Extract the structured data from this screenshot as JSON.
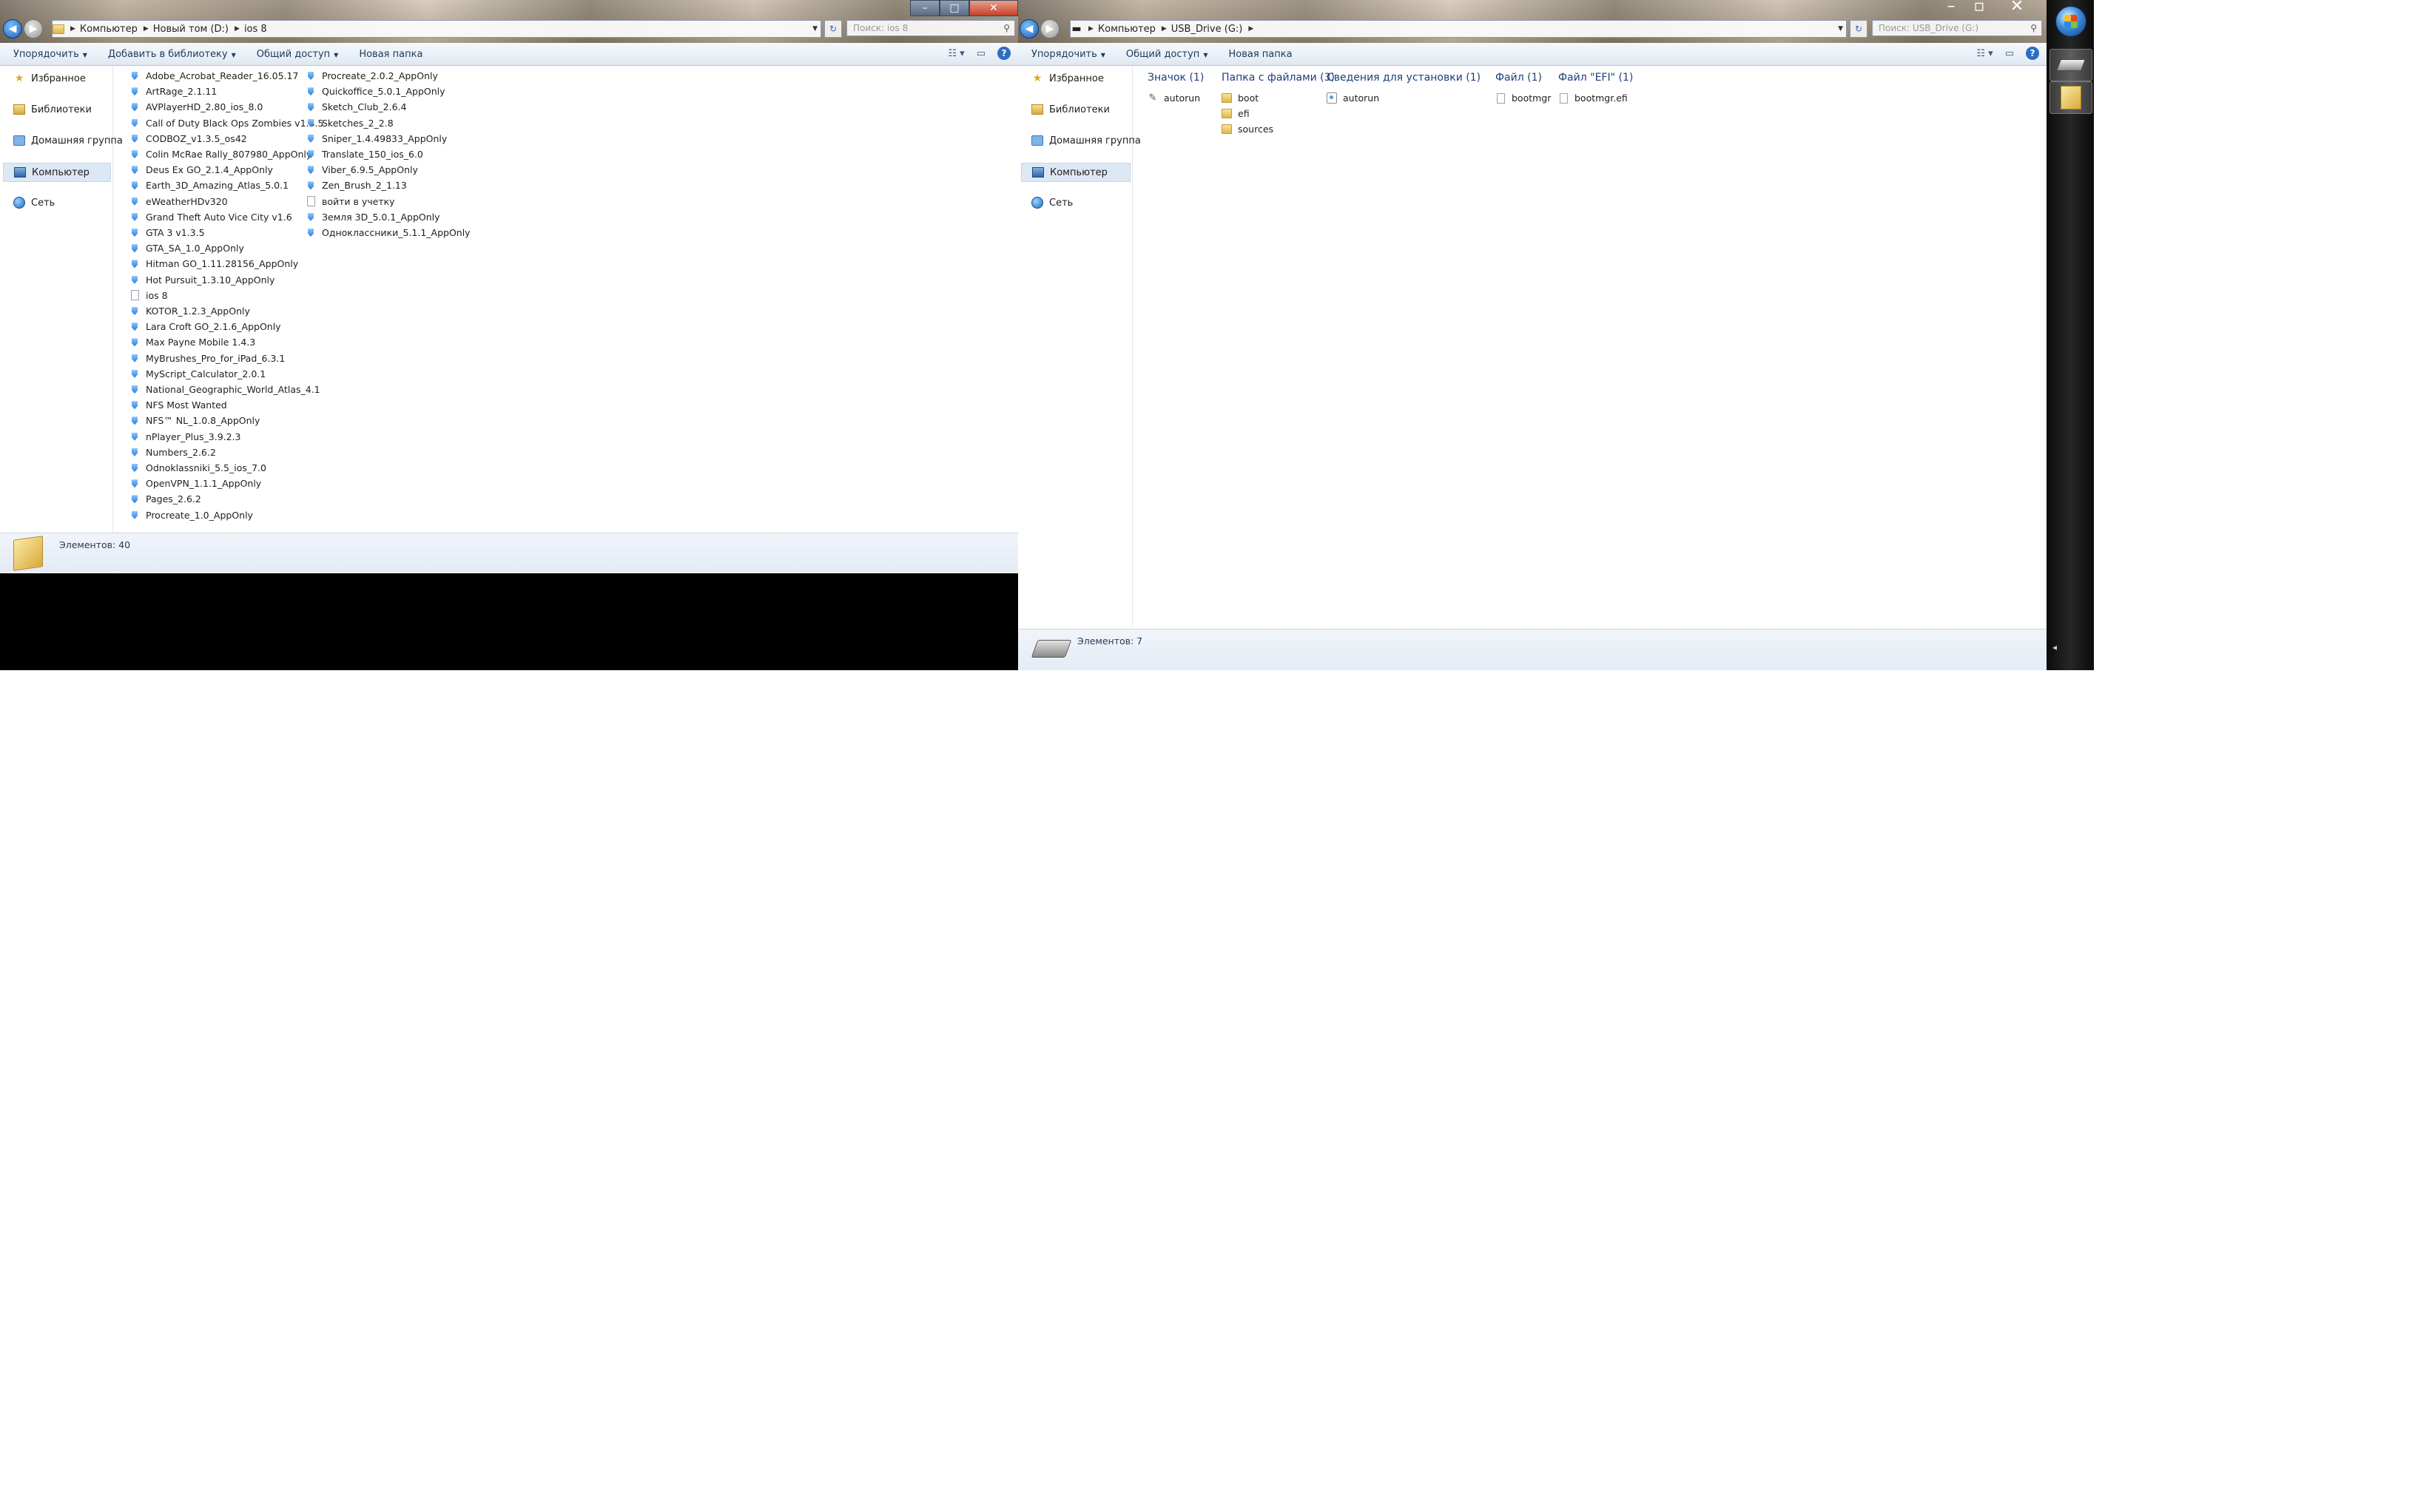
{
  "left_window": {
    "address": {
      "crumbs": [
        "Компьютер",
        "Новый том (D:)",
        "ios 8"
      ]
    },
    "search_placeholder": "Поиск: ios 8",
    "toolbar": {
      "organize": "Упорядочить",
      "add_to_library": "Добавить в библиотеку",
      "share": "Общий доступ",
      "new_folder": "Новая папка"
    },
    "nav": {
      "favorites": "Избранное",
      "libraries": "Библиотеки",
      "homegroup": "Домашняя группа",
      "computer": "Компьютер",
      "network": "Сеть"
    },
    "files_col1": [
      {
        "name": "Adobe_Acrobat_Reader_16.05.17",
        "icon": "app"
      },
      {
        "name": "ArtRage_2.1.11",
        "icon": "app"
      },
      {
        "name": "AVPlayerHD_2.80_ios_8.0",
        "icon": "app"
      },
      {
        "name": "Call of Duty Black Ops Zombies v1.3.5",
        "icon": "app"
      },
      {
        "name": "CODBOZ_v1.3.5_os42",
        "icon": "app"
      },
      {
        "name": "Colin McRae Rally_807980_AppOnly",
        "icon": "app"
      },
      {
        "name": "Deus Ex GO_2.1.4_AppOnly",
        "icon": "app"
      },
      {
        "name": "Earth_3D_Amazing_Atlas_5.0.1",
        "icon": "app"
      },
      {
        "name": "eWeatherHDv320",
        "icon": "app"
      },
      {
        "name": "Grand Theft Auto Vice City v1.6",
        "icon": "app"
      },
      {
        "name": "GTA 3 v1.3.5",
        "icon": "app"
      },
      {
        "name": "GTA_SA_1.0_AppOnly",
        "icon": "app"
      },
      {
        "name": "Hitman GO_1.11.28156_AppOnly",
        "icon": "app"
      },
      {
        "name": "Hot Pursuit_1.3.10_AppOnly",
        "icon": "app"
      },
      {
        "name": "ios 8",
        "icon": "doc"
      },
      {
        "name": "KOTOR_1.2.3_AppOnly",
        "icon": "app"
      },
      {
        "name": "Lara Croft GO_2.1.6_AppOnly",
        "icon": "app"
      },
      {
        "name": "Max Payne Mobile 1.4.3",
        "icon": "app"
      },
      {
        "name": "MyBrushes_Pro_for_iPad_6.3.1",
        "icon": "app"
      },
      {
        "name": "MyScript_Calculator_2.0.1",
        "icon": "app"
      },
      {
        "name": "National_Geographic_World_Atlas_4.1",
        "icon": "app"
      },
      {
        "name": "NFS Most Wanted",
        "icon": "app"
      },
      {
        "name": "NFS™ NL_1.0.8_AppOnly",
        "icon": "app"
      },
      {
        "name": "nPlayer_Plus_3.9.2.3",
        "icon": "app"
      },
      {
        "name": "Numbers_2.6.2",
        "icon": "app"
      },
      {
        "name": "Odnoklassniki_5.5_ios_7.0",
        "icon": "app"
      },
      {
        "name": "OpenVPN_1.1.1_AppOnly",
        "icon": "app"
      },
      {
        "name": "Pages_2.6.2",
        "icon": "app"
      },
      {
        "name": "Procreate_1.0_AppOnly",
        "icon": "app"
      }
    ],
    "files_col2": [
      {
        "name": "Procreate_2.0.2_AppOnly",
        "icon": "app"
      },
      {
        "name": "Quickoffice_5.0.1_AppOnly",
        "icon": "app"
      },
      {
        "name": "Sketch_Club_2.6.4",
        "icon": "app"
      },
      {
        "name": "Sketches_2_2.8",
        "icon": "app"
      },
      {
        "name": "Sniper_1.4.49833_AppOnly",
        "icon": "app"
      },
      {
        "name": "Translate_150_ios_6.0",
        "icon": "app"
      },
      {
        "name": "Viber_6.9.5_AppOnly",
        "icon": "app"
      },
      {
        "name": "Zen_Brush_2_1.13",
        "icon": "app"
      },
      {
        "name": "войти в учетку",
        "icon": "doc"
      },
      {
        "name": "Земля 3D_5.0.1_AppOnly",
        "icon": "app"
      },
      {
        "name": "Одноклассники_5.1.1_AppOnly",
        "icon": "app"
      }
    ],
    "status": "Элементов: 40"
  },
  "right_window": {
    "address": {
      "crumbs": [
        "Компьютер",
        "USB_Drive (G:)"
      ]
    },
    "search_placeholder": "Поиск: USB_Drive (G:)",
    "toolbar": {
      "organize": "Упорядочить",
      "share": "Общий доступ",
      "new_folder": "Новая папка"
    },
    "nav": {
      "favorites": "Избранное",
      "libraries": "Библиотеки",
      "homegroup": "Домашняя группа",
      "computer": "Компьютер",
      "network": "Сеть"
    },
    "groups": [
      {
        "header": "Значок (1)",
        "items": [
          {
            "name": "autorun",
            "icon": "wrench"
          }
        ]
      },
      {
        "header": "Папка с файлами (3)",
        "items": [
          {
            "name": "boot",
            "icon": "folder"
          },
          {
            "name": "efi",
            "icon": "folder"
          },
          {
            "name": "sources",
            "icon": "folder"
          }
        ]
      },
      {
        "header": "Сведения для установки (1)",
        "items": [
          {
            "name": "autorun",
            "icon": "autorun"
          }
        ]
      },
      {
        "header": "Файл (1)",
        "items": [
          {
            "name": "bootmgr",
            "icon": "doc"
          }
        ]
      },
      {
        "header": "Файл \"EFI\" (1)",
        "items": [
          {
            "name": "bootmgr.efi",
            "icon": "doc"
          }
        ]
      }
    ],
    "status": "Элементов: 7"
  },
  "icons": {
    "back": "back-arrow-icon",
    "forward": "forward-arrow-icon",
    "refresh": "refresh-icon",
    "search": "search-icon",
    "favorites": "star-icon",
    "libraries": "library-icon",
    "homegroup": "homegroup-icon",
    "computer": "computer-icon",
    "network": "network-icon",
    "help": "help-icon",
    "start": "windows-start-icon"
  },
  "colors": {
    "toolbar_text": "#1e395b",
    "group_header": "#1e3e7a",
    "selection": "#dde8f5",
    "taskbar": "#111111"
  }
}
